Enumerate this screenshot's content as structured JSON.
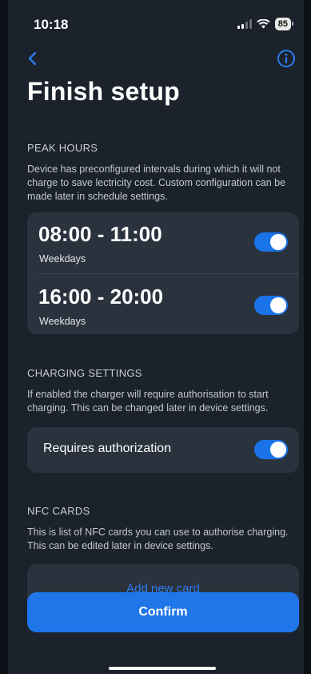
{
  "status_bar": {
    "time": "10:18",
    "battery": "85"
  },
  "header": {
    "title": "Finish setup"
  },
  "peak_hours": {
    "label": "PEAK HOURS",
    "description": "Device has preconfigured intervals during which it will not charge to save lectricity cost. Custom configuration can be made later in schedule settings.",
    "intervals": [
      {
        "time": "08:00 - 11:00",
        "days": "Weekdays",
        "enabled": true
      },
      {
        "time": "16:00 - 20:00",
        "days": "Weekdays",
        "enabled": true
      }
    ]
  },
  "charging_settings": {
    "label": "CHARGING SETTINGS",
    "description": "If enabled the charger will require authorisation to start charging. This can be changed later in device settings.",
    "requires_auth_label": "Requires authorization",
    "requires_auth_enabled": true
  },
  "nfc_cards": {
    "label": "NFC CARDS",
    "description": "This is list of NFC cards you can use to authorise charging. This can be edited later in device settings.",
    "add_card_label": "Add new card"
  },
  "footer": {
    "confirm_label": "Confirm"
  },
  "colors": {
    "accent": "#1f76e9",
    "background": "#1b222c",
    "card": "#2a323d"
  },
  "icons": {
    "back": "chevron-left-icon",
    "info": "info-icon"
  }
}
